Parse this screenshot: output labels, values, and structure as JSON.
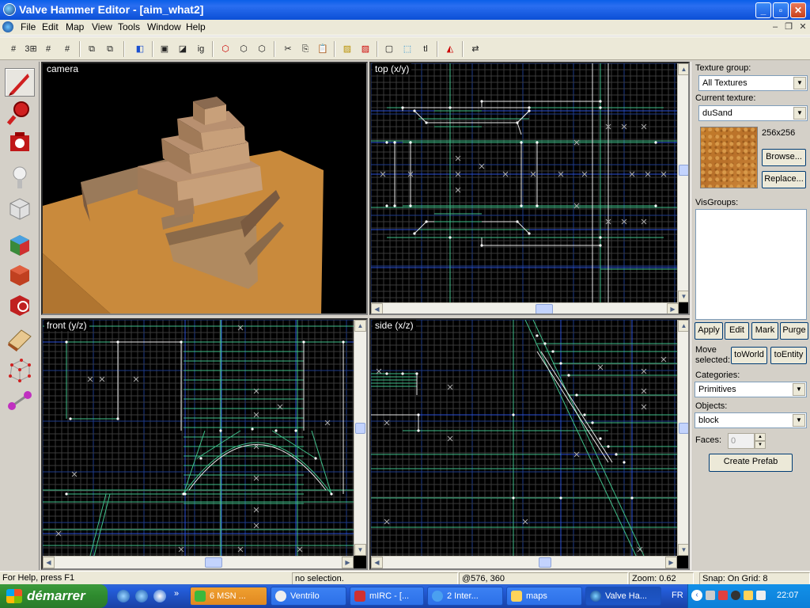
{
  "window": {
    "title": "Valve Hammer Editor - [aim_what2]"
  },
  "menu": [
    "File",
    "Edit",
    "Map",
    "View",
    "Tools",
    "Window",
    "Help"
  ],
  "toolbar": {
    "text_tools": [
      "ig",
      "tl"
    ]
  },
  "viewports": {
    "camera": "camera",
    "top": "top (x/y)",
    "front": "front (y/z)",
    "side": "side (x/z)"
  },
  "right_panel": {
    "texture_group_label": "Texture group:",
    "texture_group_value": "All Textures",
    "current_texture_label": "Current texture:",
    "current_texture_value": "duSand",
    "texture_size": "256x256",
    "browse_button": "Browse...",
    "replace_button": "Replace...",
    "visgroups_label": "VisGroups:",
    "apply_button": "Apply",
    "edit_button": "Edit",
    "mark_button": "Mark",
    "purge_button": "Purge",
    "move_selected_label_1": "Move",
    "move_selected_label_2": "selected:",
    "to_world_button": "toWorld",
    "to_entity_button": "toEntity",
    "categories_label": "Categories:",
    "categories_value": "Primitives",
    "objects_label": "Objects:",
    "objects_value": "block",
    "faces_label": "Faces:",
    "faces_value": "0",
    "create_prefab_button": "Create Prefab"
  },
  "status": {
    "help": "For Help, press F1",
    "selection": "no selection.",
    "coords": "@576, 360",
    "zoom": "Zoom: 0.62",
    "snap": "Snap: On Grid: 8"
  },
  "taskbar": {
    "start": "démarrer",
    "tasks": [
      "6 MSN ...",
      "Ventrilo",
      "mIRC - [...",
      "2 Inter...",
      "maps",
      "Valve Ha..."
    ],
    "language": "FR",
    "clock": "22:07"
  },
  "colors": {
    "grid_minor": "#3a3a3a",
    "grid_major": "#1e3c8c",
    "brush_green": "#3fc08a",
    "brush_white": "#e8e8e8",
    "brush_blue": "#2a50d8",
    "sand": "#c98a3c"
  }
}
